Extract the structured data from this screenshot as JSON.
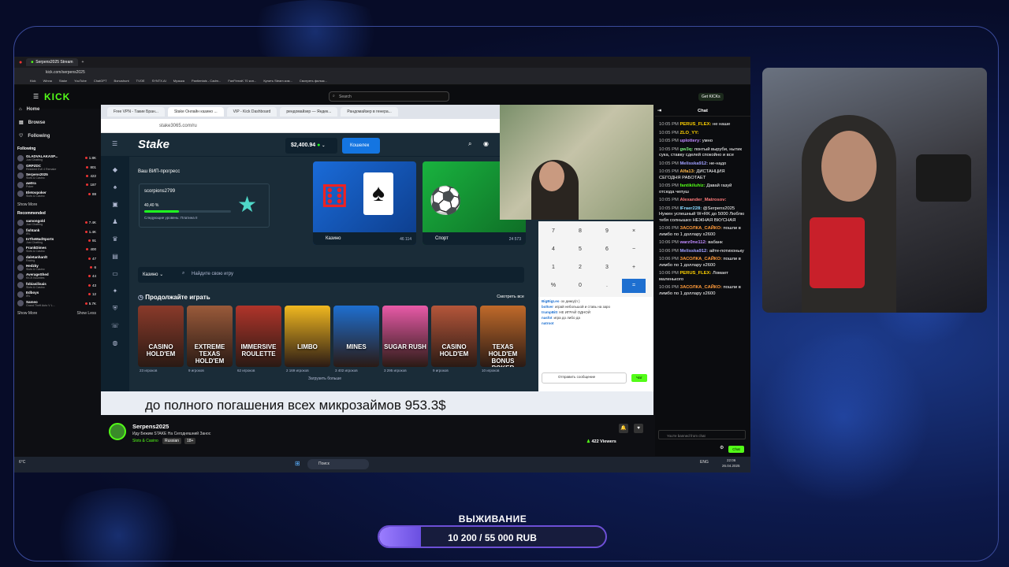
{
  "browser": {
    "tab_title": "Serpens2025 Stream",
    "url": "kick.com/serpens2025",
    "bookmarks": [
      "Kick",
      "Winna",
      "Stake",
      "YouTube",
      "ChatGPT",
      "Bonushunt",
      "TVOE",
      "SYNTX.AI",
      "Музыка",
      "Pantientals - Cadm...",
      "FanFirmaK 70 кон...",
      "Купить Steam ком...",
      "Смотреть фильм..."
    ]
  },
  "kick": {
    "logo": "KICK",
    "search_placeholder": "Search",
    "get_kicks": "Get KICKs",
    "nav": {
      "home": "Home",
      "browse": "Browse",
      "following": "Following"
    },
    "following_title": "Following",
    "following": [
      {
        "name": "GLADVALAKASP...",
        "game": "Just Chatting",
        "viewers": "1.8K"
      },
      {
        "name": "GRPZDC",
        "game": "Resident Evil 4 Remake",
        "viewers": "801"
      },
      {
        "name": "Serpens2025",
        "game": "Slots & Casino",
        "viewers": "422"
      },
      {
        "name": "aw0ra",
        "game": "Poker",
        "viewers": "187"
      },
      {
        "name": "Eletovpoker",
        "game": "Slots & Casino",
        "viewers": "88"
      }
    ],
    "show_more": "Show More",
    "recommended_title": "Recommended",
    "recommended": [
      {
        "name": "samongold",
        "game": "Just Chatting",
        "viewers": "7.4K"
      },
      {
        "name": "fishtank",
        "game": "IRL",
        "viewers": "1.4K"
      },
      {
        "name": "InTheMadSports",
        "game": "Just Chatting",
        "viewers": "91"
      },
      {
        "name": "FrankDimes",
        "game": "Slots & Casino",
        "viewers": "400"
      },
      {
        "name": "daletanhardt",
        "game": "Racing",
        "viewers": "47"
      },
      {
        "name": "Hedzky",
        "game": "Slots & Casino",
        "viewers": "6"
      },
      {
        "name": "AverageShed",
        "game": "KICK Bounties",
        "viewers": "44"
      },
      {
        "name": "fobiasilisais",
        "game": "Slots & Casino",
        "viewers": "43"
      },
      {
        "name": "Edboys",
        "game": "IRL",
        "viewers": "12"
      },
      {
        "name": "Sameo",
        "game": "Grand Theft Auto V L...",
        "viewers": "5.7K"
      }
    ],
    "show_more_2": "Show More",
    "show_less": "Show Less"
  },
  "inner_browser": {
    "tabs": [
      "Free VPN - Такие Бран...",
      "Stake Онлайн казино ...",
      "VIP - Kick Dashboard",
      "рендомайзер — Яндек...",
      "Рандомайзер в генера..."
    ],
    "url": "stake3065.com/ru"
  },
  "stake": {
    "logo": "Stake",
    "balance": "$2,400.94",
    "deposit": "Кошелек",
    "vip_title": "Ваш ВИП-прогресс",
    "vip_user": "scorpions2799",
    "vip_progress_text": "40,40 %",
    "vip_progress": 0.404,
    "vip_next": "Следующие уровень: Платина II",
    "casino_label": "Казино",
    "casino_count": "46 114",
    "sport_label": "Спорт",
    "sport_count": "24 573",
    "select_label": "Казино",
    "search_placeholder": "Найдите свою игру",
    "continue_title": "Продолжайте играть",
    "see_all": "Смотреть все",
    "games": [
      {
        "name": "CASINO HOLD'EM",
        "players": "23 игроков",
        "color": "#8a3a2a"
      },
      {
        "name": "EXTREME TEXAS HOLD'EM",
        "players": "9 игроков",
        "color": "#9a5a3a"
      },
      {
        "name": "IMMERSIVE ROULETTE",
        "players": "62 игроков",
        "color": "#b0342a"
      },
      {
        "name": "LIMBO",
        "players": "2 169 игроков",
        "color": "#f0b820"
      },
      {
        "name": "MINES",
        "players": "3 402 игроков",
        "color": "#1e6fd0"
      },
      {
        "name": "SUGAR RUSH",
        "players": "3 295 игроков",
        "color": "#e85aa8"
      },
      {
        "name": "CASINO HOLD'EM",
        "players": "9 игроков",
        "color": "#b5563a"
      },
      {
        "name": "TEXAS HOLD'EM BONUS POKER",
        "players": "10 игроков",
        "color": "#c06a2a"
      }
    ],
    "load_more": "Загрузить больше"
  },
  "calculator": {
    "keys": [
      "7",
      "8",
      "9",
      "×",
      "4",
      "5",
      "6",
      "−",
      "1",
      "2",
      "3",
      "+",
      "%",
      "0",
      ".",
      "="
    ]
  },
  "minichat": [
    {
      "user": "BigBigLeo",
      "text": "ох дикку(п )"
    },
    {
      "user": "boltver",
      "text": "играй небольшой и ставь на заро"
    },
    {
      "user": "trumpBitt",
      "text": "НЕ ИГРАЙ ОДНОЙ"
    },
    {
      "user": "nasfot",
      "text": "игра до либо да"
    },
    {
      "user": "natroot",
      "text": ""
    }
  ],
  "minichat_input": "Отправить сообщение",
  "minichat_send": "Чат",
  "subtitle": "до полного погашения всех микрозаймов 953.3$",
  "stream": {
    "streamer": "Serpens2025",
    "title": "Иду Бежим STAKE На Сегодняшний Занос",
    "category": "Slots & Casino",
    "tag_language": "Russian",
    "tag_age": "18+",
    "viewers": "422 Viewers"
  },
  "chat": {
    "title": "Chat",
    "messages": [
      {
        "time": "10:05 PM",
        "user": "PERUS_FLEX:",
        "color": "#ffd200",
        "text": "не наше"
      },
      {
        "time": "10:05 PM",
        "user": "ZLO_YY:",
        "color": "#ffd200",
        "text": ""
      },
      {
        "time": "10:05 PM",
        "user": "uplottery:",
        "color": "#c08aff",
        "text": "умно"
      },
      {
        "time": "10:05 PM",
        "user": "gw3q:",
        "color": "#7cf27c",
        "text": "понтый выруби, нытик сука, ставку сделей спокойно и все"
      },
      {
        "time": "10:05 PM",
        "user": "Melisska912:",
        "color": "#a0a0ff",
        "text": "не-надо"
      },
      {
        "time": "10:05 PM",
        "user": "Alfa13:",
        "color": "#ffb84a",
        "text": "ДИСТАНЦИЯ СЕГОДНЯ РАБОТАЕТ"
      },
      {
        "time": "10:05 PM",
        "user": "fantikiluhiz:",
        "color": "#53fc18",
        "text": "Давай газуй отсюда чепуш"
      },
      {
        "time": "10:05 PM",
        "user": "Alexander_Matrosov:",
        "color": "#ff7a7a",
        "text": ""
      },
      {
        "time": "10:05 PM",
        "user": "IFraer228:",
        "color": "#8ad8ff",
        "text": "@Serpens2025 Нужен успешный W+RK до 5000 Люблю тебя солнышко НЕЖНАЯ ВКУСНАЯ"
      },
      {
        "time": "10:06 PM",
        "user": "ЗАСОЛКА_САЙКО:",
        "color": "#ff9a3a",
        "text": "пошли в лимбо по 1 доллару x2600"
      },
      {
        "time": "10:06 PM",
        "user": "warz0ne112:",
        "color": "#c08aff",
        "text": "вабанк"
      },
      {
        "time": "10:06 PM",
        "user": "Melisska912:",
        "color": "#a0a0ff",
        "text": "айте-потихоньку"
      },
      {
        "time": "10:06 PM",
        "user": "ЗАСОЛКА_САЙКО:",
        "color": "#ff9a3a",
        "text": "пошли в лимбо по 1 доллару x2600"
      },
      {
        "time": "10:06 PM",
        "user": "PERUS_FLEX:",
        "color": "#ffd200",
        "text": "Ломает маленького"
      },
      {
        "time": "10:06 PM",
        "user": "ЗАСОЛКА_САЙКО:",
        "color": "#ff9a3a",
        "text": "пошли в лимбо по 1 доллару x2600"
      }
    ],
    "banned": "You're banned from chat",
    "chat_button": "Chat"
  },
  "win_taskbar": {
    "search": "Поиск",
    "weather": "6°C",
    "lang": "ENG",
    "time": "22:06",
    "date": "26.04.2025"
  },
  "survival": {
    "label": "ВЫЖИВАНИЕ",
    "text": "10 200 / 55 000 RUB",
    "progress": 0.185
  }
}
